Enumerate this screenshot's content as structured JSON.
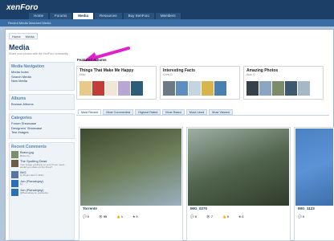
{
  "brand": {
    "logo": "xenForo"
  },
  "nav": {
    "tabs": [
      "Home",
      "Forums",
      "Media",
      "Resources",
      "Buy XenForo",
      "Members"
    ]
  },
  "subnav": {
    "text": "Recent Media  Watched Media"
  },
  "breadcrumb": {
    "items": [
      "Home",
      "Media"
    ]
  },
  "page": {
    "title": "Media",
    "description": "Share your photos with the XenForo community"
  },
  "sidebar": {
    "media_nav": {
      "heading": "Media Navigation",
      "links": [
        "Media Index",
        "Search Media",
        "New Media"
      ]
    },
    "albums": {
      "heading": "Albums",
      "links": [
        "Browse Albums"
      ]
    },
    "categories": {
      "heading": "Categories",
      "links": [
        "Forum Showcase",
        "Designers' Showcase",
        "Test Images"
      ]
    },
    "recent": {
      "heading": "Recent Comments",
      "items": [
        {
          "title": "Bravo.jpg",
          "sub": "Bravo by..."
        },
        {
          "title": "The Spotting Dead",
          "sub": "Your image positions on your forum need... would you share us the three?"
        },
        {
          "title": "IMG",
          "sub": "by Bryan Stoll © 2013..."
        },
        {
          "title": "Jon (Pseudojay)",
          "sub": "by ..."
        },
        {
          "title": "Jon (Pseudojay)",
          "sub": "@Pseudojay.do yourselve..."
        }
      ]
    }
  },
  "featured": {
    "label": "Featured Albums",
    "albums": [
      {
        "title": "Things That Make Me Happy",
        "user": "Mika",
        "thumbs": [
          "#e8c98a",
          "#c23c3a",
          "#f0e7d4",
          "#b8a7d3",
          "#2c5e7a"
        ]
      },
      {
        "title": "Interesting Facts",
        "user": "Chris D.",
        "thumbs": [
          "#6c7a88",
          "#5c8fbf",
          "#c4d4e0",
          "#d9b44a",
          "#4a7fb0"
        ]
      },
      {
        "title": "Amazing Photos",
        "user": "Alan G.",
        "thumbs": [
          "#35404a",
          "#8ba6c0",
          "#7b8c6b",
          "#3e5870",
          "#a4b8c6"
        ]
      }
    ]
  },
  "sort_tabs": [
    "Most Recent",
    "Most Commented",
    "Highest Rated",
    "Most Rated",
    "Most Liked",
    "Most Viewed"
  ],
  "media": [
    {
      "name": "Torrente",
      "stats": [
        "0",
        "95",
        "1",
        "0"
      ],
      "grad": [
        "#3d4a2e",
        "#6e7f5b",
        "#9ab0c0"
      ]
    },
    {
      "name": "IMG_0270",
      "stats": [
        "0",
        "7",
        "0",
        "0"
      ],
      "grad": [
        "#9fb0a3",
        "#52654e",
        "#2f3c2a"
      ]
    },
    {
      "name": "IMG_1123",
      "stats": [
        "0",
        "",
        "",
        ""
      ],
      "grad": [
        "#4b82c4",
        "#5b93d6",
        "#3d6fab"
      ]
    }
  ],
  "colors": {
    "brand_dark": "#1c3f67",
    "accent": "#5a85b3",
    "arrow": "#e21fd0"
  },
  "icons": [
    "comment-icon",
    "eye-icon",
    "like-icon",
    "star-icon"
  ]
}
